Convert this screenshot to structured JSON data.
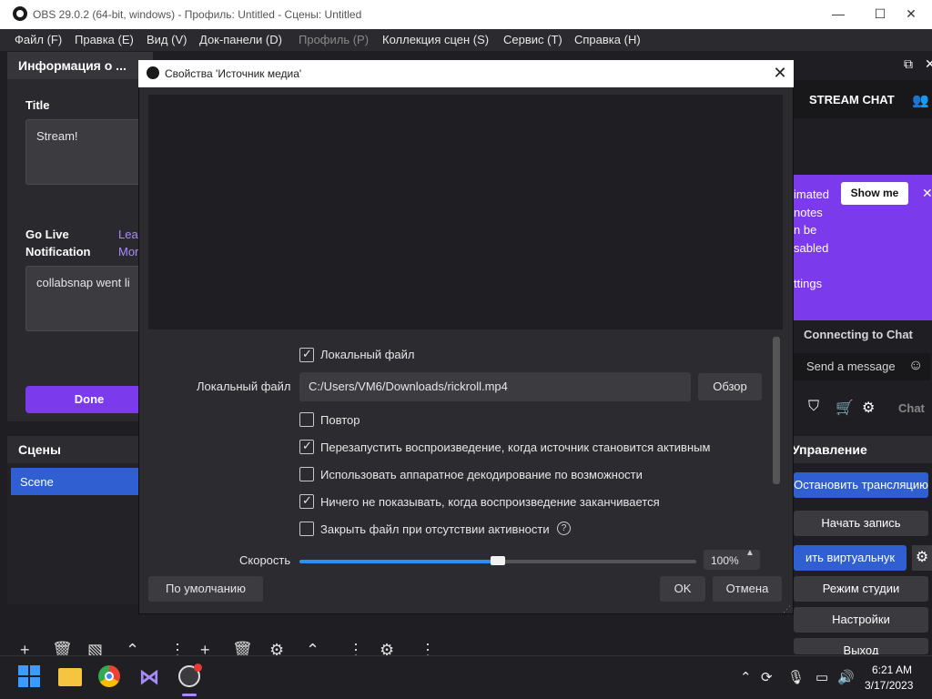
{
  "window": {
    "title": "OBS 29.0.2 (64-bit, windows) - Профиль: Untitled - Сцены: Untitled",
    "minimize_glyph": "—",
    "maximize_glyph": "☐",
    "close_glyph": "✕"
  },
  "menu": [
    {
      "label": "Файл (F)",
      "enabled": true
    },
    {
      "label": "Правка (E)",
      "enabled": true
    },
    {
      "label": "Вид (V)",
      "enabled": true
    },
    {
      "label": "Док-панели (D)",
      "enabled": true
    },
    {
      "label": "Профиль (P)",
      "enabled": false
    },
    {
      "label": "Коллекция сцен (S)",
      "enabled": true
    },
    {
      "label": "Сервис (T)",
      "enabled": true
    },
    {
      "label": "Справка (H)",
      "enabled": true
    }
  ],
  "info_dock": {
    "header": "Информация о ...",
    "title_label": "Title",
    "title_value": "Stream!",
    "golive_label_1": "Go Live",
    "golive_label_2": "Notification",
    "golive_link_1": "Lea",
    "golive_link_2": "Mor",
    "golive_value": "collabsnap went li",
    "done_label": "Done"
  },
  "scenes": {
    "header": "Сцены",
    "items": [
      "Scene"
    ]
  },
  "chat": {
    "header": "STREAM CHAT",
    "show_me": "Show me",
    "promo_lines": [
      "imated",
      "notes",
      "n be",
      "sabled",
      "",
      "ttings"
    ],
    "connecting": "Connecting to Chat",
    "send_message": "Send a message",
    "chat_button": "Chat"
  },
  "controls": {
    "header": "Управление",
    "buttons": [
      "Остановить трансляцию",
      "Начать запись",
      "ить виртуальнук",
      "Режим студии",
      "Настройки",
      "Выход"
    ]
  },
  "dialog": {
    "title": "Свойства 'Источник медиа'",
    "local_file_checkbox": {
      "label": "Локальный файл",
      "checked": true
    },
    "path_label": "Локальный файл",
    "path_value": "C:/Users/VM6/Downloads/rickroll.mp4",
    "browse_label": "Обзор",
    "options": [
      {
        "label": "Повтор",
        "checked": false
      },
      {
        "label": "Перезапустить воспроизведение, когда источник становится активным",
        "checked": true
      },
      {
        "label": "Использовать аппаратное декодирование по возможности",
        "checked": false
      },
      {
        "label": "Ничего не показывать, когда воспроизведение заканчивается",
        "checked": true
      },
      {
        "label": "Закрыть файл при отсутствии активности",
        "checked": false
      }
    ],
    "speed_label": "Скорость",
    "speed_value": "100%",
    "speed_fraction": 0.5,
    "defaults_label": "По умолчанию",
    "ok_label": "OK",
    "cancel_label": "Отмена"
  },
  "taskbar": {
    "time": "6:21 AM",
    "date": "3/17/2023"
  },
  "colors": {
    "accent_purple": "#7c3aed",
    "accent_blue": "#2f5fd0",
    "panel_bg": "#2b2b30"
  }
}
